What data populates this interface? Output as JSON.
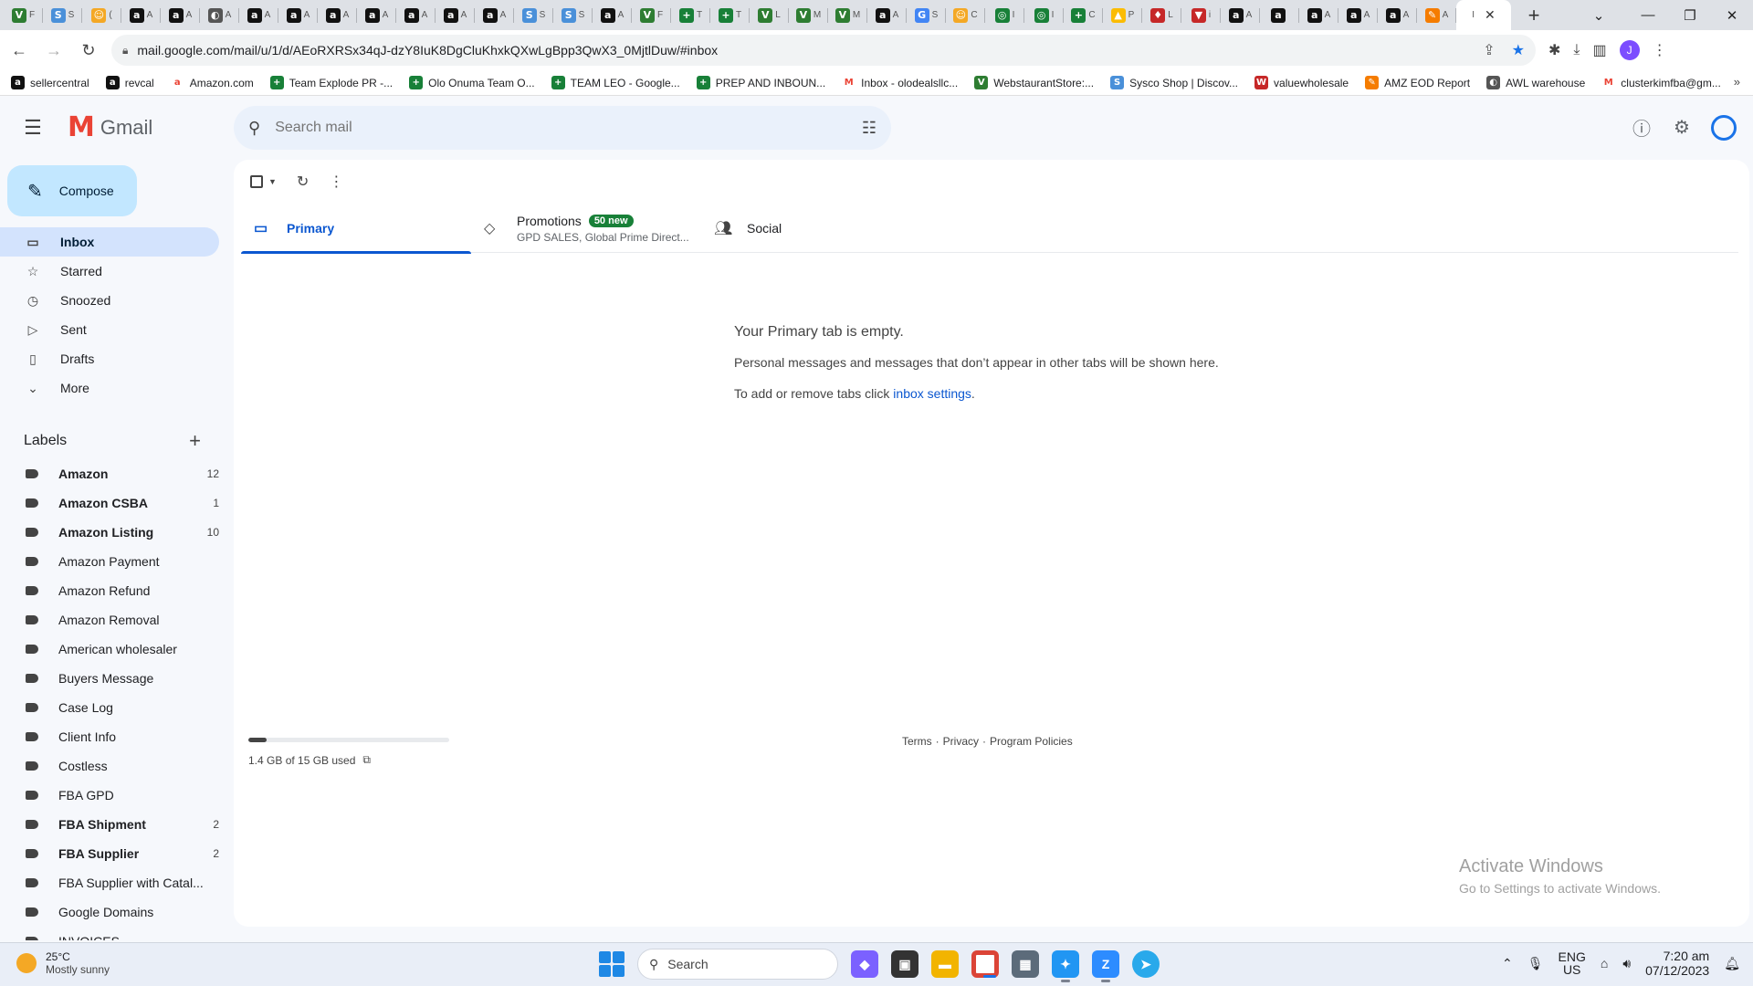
{
  "browser": {
    "tabs": [
      {
        "icon": "V",
        "color": "#2e7d32",
        "text": "F"
      },
      {
        "icon": "S",
        "color": "#4a90d9",
        "text": "S"
      },
      {
        "icon": "☺",
        "color": "#f4a825",
        "text": "("
      },
      {
        "icon": "a",
        "color": "#111111",
        "text": "A"
      },
      {
        "icon": "a",
        "color": "#111111",
        "text": "A"
      },
      {
        "icon": "◐",
        "color": "#555555",
        "text": "A"
      },
      {
        "icon": "a",
        "color": "#111111",
        "text": "A"
      },
      {
        "icon": "a",
        "color": "#111111",
        "text": "A"
      },
      {
        "icon": "a",
        "color": "#111111",
        "text": "A"
      },
      {
        "icon": "a",
        "color": "#111111",
        "text": "A"
      },
      {
        "icon": "a",
        "color": "#111111",
        "text": "A"
      },
      {
        "icon": "a",
        "color": "#111111",
        "text": "A"
      },
      {
        "icon": "a",
        "color": "#111111",
        "text": "A"
      },
      {
        "icon": "S",
        "color": "#4a90d9",
        "text": "S"
      },
      {
        "icon": "S",
        "color": "#4a90d9",
        "text": "S"
      },
      {
        "icon": "a",
        "color": "#111111",
        "text": "A"
      },
      {
        "icon": "V",
        "color": "#2e7d32",
        "text": "F"
      },
      {
        "icon": "+",
        "color": "#188038",
        "text": "T"
      },
      {
        "icon": "+",
        "color": "#188038",
        "text": "T"
      },
      {
        "icon": "V",
        "color": "#2e7d32",
        "text": "L"
      },
      {
        "icon": "V",
        "color": "#2e7d32",
        "text": "M"
      },
      {
        "icon": "V",
        "color": "#2e7d32",
        "text": "M"
      },
      {
        "icon": "a",
        "color": "#111111",
        "text": "A"
      },
      {
        "icon": "G",
        "color": "#4285f4",
        "text": "S"
      },
      {
        "icon": "☺",
        "color": "#f4a825",
        "text": "C"
      },
      {
        "icon": "◎",
        "color": "#188038",
        "text": "I"
      },
      {
        "icon": "◎",
        "color": "#188038",
        "text": "I"
      },
      {
        "icon": "+",
        "color": "#188038",
        "text": "C"
      },
      {
        "icon": "▲",
        "color": "#fbbc04",
        "text": "P"
      },
      {
        "icon": "♦",
        "color": "#c62828",
        "text": "L"
      },
      {
        "icon": "▼",
        "color": "#c62828",
        "text": "i"
      },
      {
        "icon": "a",
        "color": "#111111",
        "text": "A"
      },
      {
        "icon": "a",
        "color": "#111111",
        "text": ""
      },
      {
        "icon": "a",
        "color": "#111111",
        "text": "A"
      },
      {
        "icon": "a",
        "color": "#111111",
        "text": "A"
      },
      {
        "icon": "a",
        "color": "#111111",
        "text": "A"
      },
      {
        "icon": "✎",
        "color": "#f57c00",
        "text": "A"
      }
    ],
    "active_tab_icon": "I",
    "url": "mail.google.com/mail/u/1/d/AEoRXRSx34qJ-dzY8IuK8DgCluKhxkQXwLgBpp3QwX3_0MjtlDuw/#inbox",
    "profile_letter": "J",
    "bookmarks": [
      {
        "label": "sellercentral",
        "icon": "a",
        "color": "#111111"
      },
      {
        "label": "revcal",
        "icon": "a",
        "color": "#111111"
      },
      {
        "label": "Amazon.com",
        "icon": "a",
        "color": "#ffffff"
      },
      {
        "label": "Team Explode PR -...",
        "icon": "+",
        "color": "#188038"
      },
      {
        "label": "Olo Onuma Team O...",
        "icon": "+",
        "color": "#188038"
      },
      {
        "label": "TEAM LEO - Google...",
        "icon": "+",
        "color": "#188038"
      },
      {
        "label": "PREP AND INBOUN...",
        "icon": "+",
        "color": "#188038"
      },
      {
        "label": "Inbox - olodealsllc...",
        "icon": "M",
        "color": "#ffffff"
      },
      {
        "label": "WebstaurantStore:...",
        "icon": "V",
        "color": "#2e7d32"
      },
      {
        "label": "Sysco Shop | Discov...",
        "icon": "S",
        "color": "#4a90d9"
      },
      {
        "label": "valuewholesale",
        "icon": "W",
        "color": "#c62828"
      },
      {
        "label": "AMZ EOD Report",
        "icon": "✎",
        "color": "#f57c00"
      },
      {
        "label": "AWL warehouse",
        "icon": "◐",
        "color": "#555555"
      },
      {
        "label": "clusterkimfba@gm...",
        "icon": "M",
        "color": "#ffffff"
      }
    ]
  },
  "gmail": {
    "brand": "Gmail",
    "search_placeholder": "Search mail",
    "compose": "Compose",
    "nav": [
      {
        "label": "Inbox",
        "icon": "▭",
        "name": "inbox",
        "active": true
      },
      {
        "label": "Starred",
        "icon": "☆",
        "name": "starred",
        "active": false
      },
      {
        "label": "Snoozed",
        "icon": "◷",
        "name": "snoozed",
        "active": false
      },
      {
        "label": "Sent",
        "icon": "▷",
        "name": "sent",
        "active": false
      },
      {
        "label": "Drafts",
        "icon": "▯",
        "name": "drafts",
        "active": false
      },
      {
        "label": "More",
        "icon": "⌄",
        "name": "more",
        "active": false
      }
    ],
    "labels_title": "Labels",
    "labels": [
      {
        "name": "Amazon",
        "count": "12",
        "bold": true
      },
      {
        "name": "Amazon CSBA",
        "count": "1",
        "bold": true
      },
      {
        "name": "Amazon Listing",
        "count": "10",
        "bold": true
      },
      {
        "name": "Amazon Payment",
        "count": "",
        "bold": false
      },
      {
        "name": "Amazon Refund",
        "count": "",
        "bold": false
      },
      {
        "name": "Amazon Removal",
        "count": "",
        "bold": false
      },
      {
        "name": "American wholesaler",
        "count": "",
        "bold": false
      },
      {
        "name": "Buyers Message",
        "count": "",
        "bold": false
      },
      {
        "name": "Case Log",
        "count": "",
        "bold": false
      },
      {
        "name": "Client Info",
        "count": "",
        "bold": false
      },
      {
        "name": "Costless",
        "count": "",
        "bold": false
      },
      {
        "name": "FBA GPD",
        "count": "",
        "bold": false
      },
      {
        "name": "FBA Shipment",
        "count": "2",
        "bold": true
      },
      {
        "name": "FBA Supplier",
        "count": "2",
        "bold": true
      },
      {
        "name": "FBA Supplier with Catal...",
        "count": "",
        "bold": false
      },
      {
        "name": "Google Domains",
        "count": "",
        "bold": false
      },
      {
        "name": "INVOICES",
        "count": "",
        "bold": false
      }
    ],
    "tabs": {
      "primary": "Primary",
      "promotions": "Promotions",
      "promotions_badge": "50 new",
      "promotions_sub": "GPD SALES, Global Prime Direct...",
      "social": "Social"
    },
    "empty": {
      "title": "Your Primary tab is empty.",
      "desc": "Personal messages and messages that don’t appear in other tabs will be shown here.",
      "hint_prefix": "To add or remove tabs click ",
      "hint_link": "inbox settings",
      "hint_suffix": "."
    },
    "storage": {
      "text": "1.4 GB of 15 GB used",
      "fraction": 0.093
    },
    "footer": {
      "terms": "Terms",
      "sep": "·",
      "privacy": "Privacy",
      "policies": "Program Policies"
    }
  },
  "windows": {
    "activate_title": "Activate Windows",
    "activate_sub": "Go to Settings to activate Windows.",
    "weather_temp": "25°C",
    "weather_desc": "Mostly sunny",
    "search": "Search",
    "lang1": "ENG",
    "lang2": "US",
    "time": "7:20 am",
    "date": "07/12/2023"
  },
  "colors": {
    "accent": "#0b57d0",
    "compose_bg": "#c2e7ff",
    "active_nav": "#d3e3fd",
    "badge": "#188038"
  }
}
